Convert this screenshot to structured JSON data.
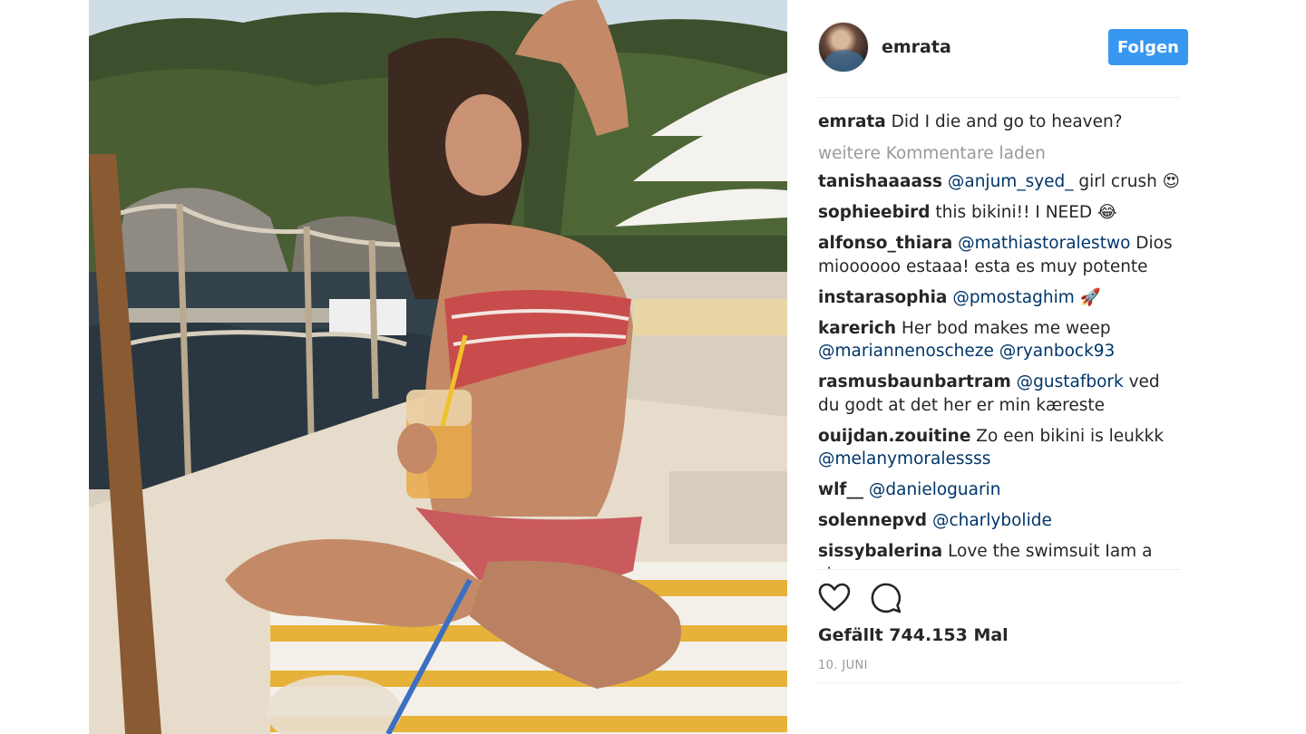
{
  "post": {
    "username": "emrata",
    "follow_label": "Folgen",
    "caption_user": "emrata",
    "caption_text": "Did I die and go to heaven?",
    "load_more": "weitere Kommentare laden",
    "likes_text": "Gefällt 744.153 Mal",
    "date": "10. JUNI"
  },
  "icons": {
    "like": "heart-icon",
    "comment": "comment-bubble-icon"
  },
  "colors": {
    "follow_bg": "#3897f0",
    "mention": "#003569",
    "muted": "#999999"
  },
  "comments": [
    {
      "user": "tanishaaaass",
      "parts": [
        {
          "mention": "@anjum_syed_"
        },
        {
          "text": " girl crush 😍"
        }
      ]
    },
    {
      "user": "sophieebird",
      "parts": [
        {
          "text": "this bikini!! I NEED 😂"
        }
      ]
    },
    {
      "user": "alfonso_thiara",
      "parts": [
        {
          "mention": "@mathiastoralestwo"
        },
        {
          "text": " Dios mioooooo estaaa! esta es muy potente"
        }
      ]
    },
    {
      "user": "instarasophia",
      "parts": [
        {
          "mention": "@pmostaghim"
        },
        {
          "text": " 🚀"
        }
      ]
    },
    {
      "user": "karerich",
      "parts": [
        {
          "text": "Her bod makes me weep "
        },
        {
          "mention": "@mariannenoscheze"
        },
        {
          "text": " "
        },
        {
          "mention": "@ryanbock93"
        }
      ]
    },
    {
      "user": "rasmusbaunbartram",
      "parts": [
        {
          "mention": "@gustafbork"
        },
        {
          "text": " ved du godt at det her er min kæreste"
        }
      ]
    },
    {
      "user": "ouijdan.zouitine",
      "parts": [
        {
          "text": "Zo een bikini is leukkk "
        },
        {
          "mention": "@melanymoralessss"
        }
      ]
    },
    {
      "user": "wlf__",
      "parts": [
        {
          "mention": "@danieloguarin"
        }
      ]
    },
    {
      "user": "solennepvd",
      "parts": [
        {
          "mention": "@charlybolide"
        }
      ]
    },
    {
      "user": "sissybalerina",
      "parts": [
        {
          "text": "Love the swimsuit Iam a sissy"
        }
      ]
    }
  ]
}
